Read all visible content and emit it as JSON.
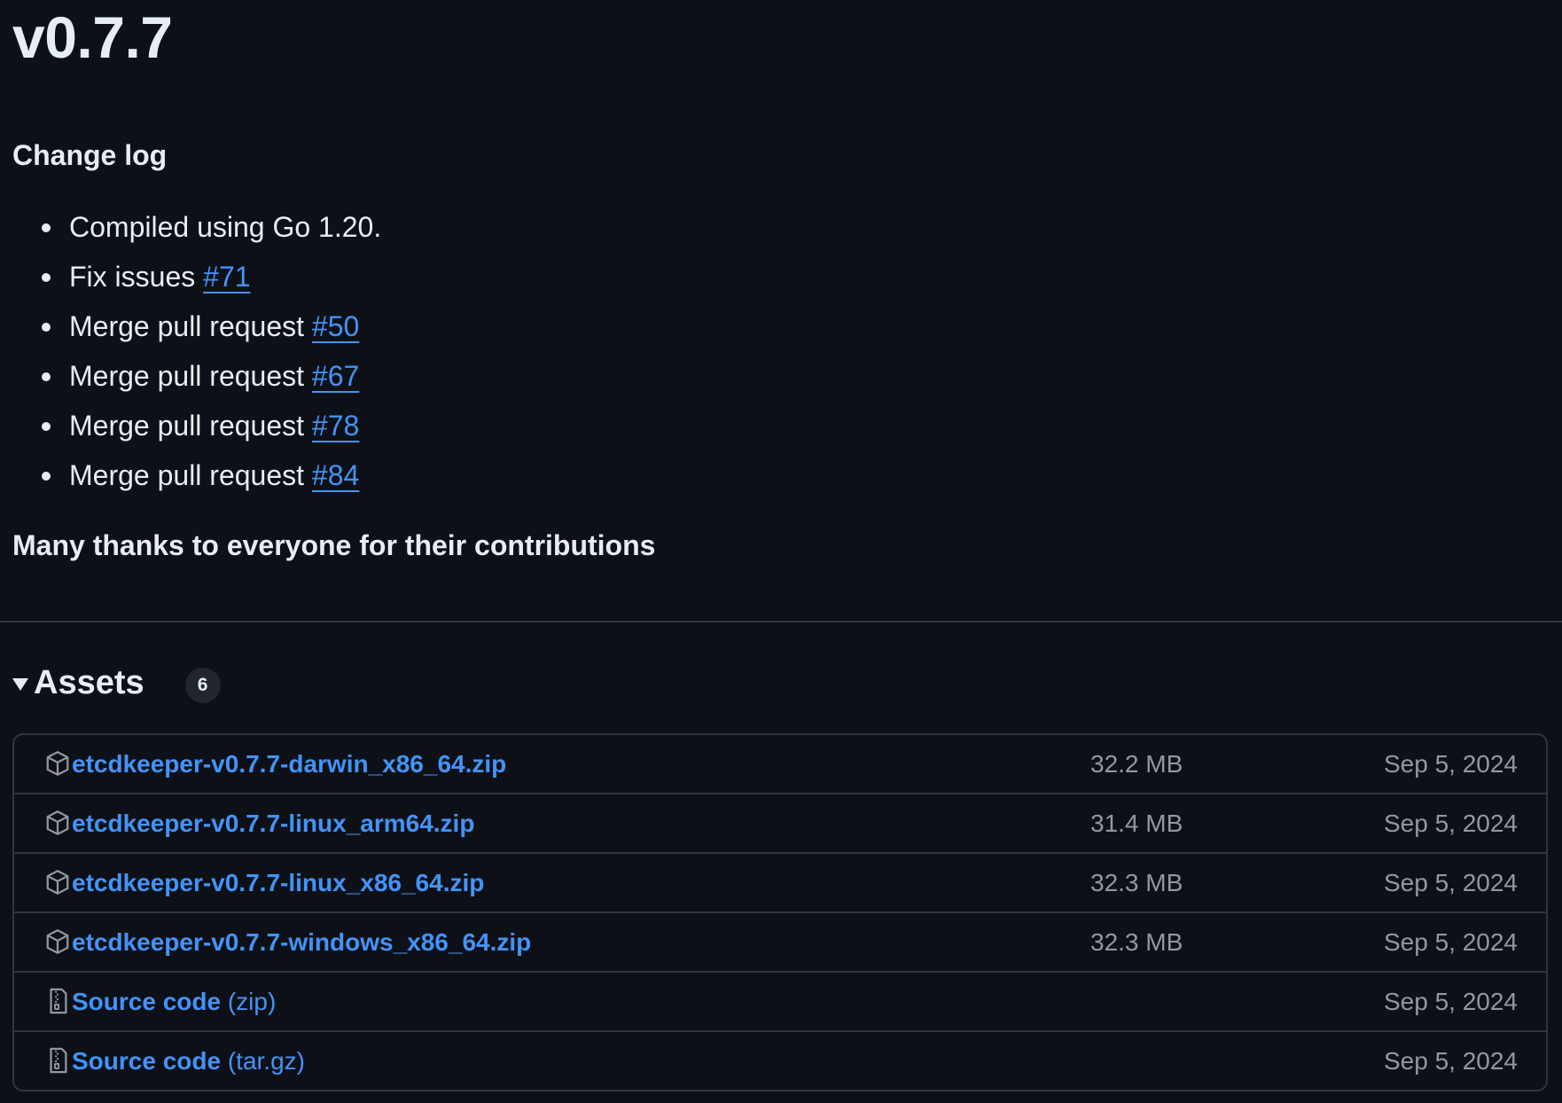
{
  "release": {
    "title": "v0.7.7",
    "changelog_heading": "Change log",
    "changelog": [
      {
        "text": "Compiled using Go 1.20.",
        "link": ""
      },
      {
        "text": "Fix issues ",
        "link": "#71"
      },
      {
        "text": "Merge pull request ",
        "link": "#50"
      },
      {
        "text": "Merge pull request ",
        "link": "#67"
      },
      {
        "text": "Merge pull request ",
        "link": "#78"
      },
      {
        "text": "Merge pull request ",
        "link": "#84"
      }
    ],
    "thanks": "Many thanks to everyone for their contributions"
  },
  "assets": {
    "title": "Assets",
    "count": "6",
    "items": [
      {
        "name": "etcdkeeper-v0.7.7-darwin_x86_64.zip",
        "suffix": "",
        "size": "32.2 MB",
        "date": "Sep 5, 2024",
        "icon": "package-icon"
      },
      {
        "name": "etcdkeeper-v0.7.7-linux_arm64.zip",
        "suffix": "",
        "size": "31.4 MB",
        "date": "Sep 5, 2024",
        "icon": "package-icon"
      },
      {
        "name": "etcdkeeper-v0.7.7-linux_x86_64.zip",
        "suffix": "",
        "size": "32.3 MB",
        "date": "Sep 5, 2024",
        "icon": "package-icon"
      },
      {
        "name": "etcdkeeper-v0.7.7-windows_x86_64.zip",
        "suffix": "",
        "size": "32.3 MB",
        "date": "Sep 5, 2024",
        "icon": "package-icon"
      },
      {
        "name": "Source code",
        "suffix": " (zip)",
        "size": "",
        "date": "Sep 5, 2024",
        "icon": "file-zip-icon"
      },
      {
        "name": "Source code",
        "suffix": " (tar.gz)",
        "size": "",
        "date": "Sep 5, 2024",
        "icon": "file-zip-icon"
      }
    ]
  },
  "colors": {
    "background": "#0d1117",
    "text": "#e6edf3",
    "link": "#4493f8",
    "muted": "#9198a1",
    "border": "#30363d"
  }
}
